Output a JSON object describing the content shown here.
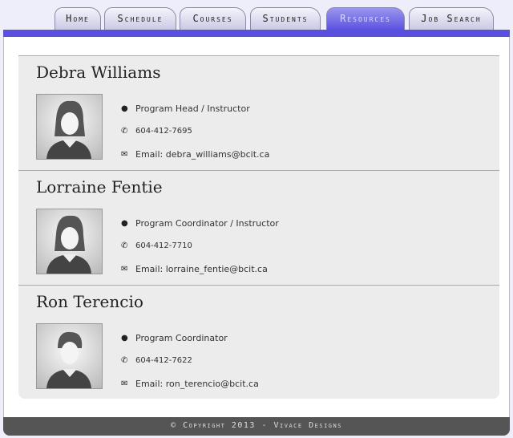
{
  "nav": {
    "tabs": [
      {
        "label": "Home"
      },
      {
        "label": "Schedule"
      },
      {
        "label": "Courses"
      },
      {
        "label": "Students"
      },
      {
        "label": "Resources",
        "active": true
      },
      {
        "label": "Job Search"
      }
    ]
  },
  "accent": "#5a50e0",
  "people": [
    {
      "name": "Debra Williams",
      "role": "Program Head / Instructor",
      "phone": "604-412-7695",
      "email": "Email: debra_williams@bcit.ca",
      "avatar": "female"
    },
    {
      "name": "Lorraine Fentie",
      "role": "Program Coordinator / Instructor",
      "phone": "604-412-7710",
      "email": "Email: lorraine_fentie@bcit.ca",
      "avatar": "female"
    },
    {
      "name": "Ron Terencio",
      "role": "Program Coordinator",
      "phone": "604-412-7622",
      "email": "Email: ron_terencio@bcit.ca",
      "avatar": "male"
    }
  ],
  "footer": {
    "text": "© Copyright 2013 - Vivace Designs"
  }
}
